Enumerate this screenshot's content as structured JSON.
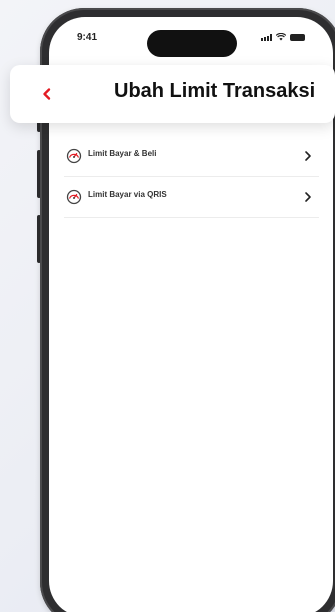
{
  "status_bar": {
    "time": "9:41",
    "icons": [
      "signal-icon",
      "wifi-icon",
      "battery-icon"
    ]
  },
  "header": {
    "back_icon": "chevron-left-icon",
    "title": "Ubah Limit Transaksi"
  },
  "menu": {
    "items": [
      {
        "label": "Limit Bayar & Beli",
        "icon": "speedometer-icon"
      },
      {
        "label": "Limit Bayar via QRIS",
        "icon": "speedometer-icon"
      }
    ]
  },
  "colors": {
    "accent": "#e31b23",
    "title_text": "#111111",
    "item_text": "#333333",
    "phone_frame": "#2e2e30",
    "background": "#eceef4"
  }
}
